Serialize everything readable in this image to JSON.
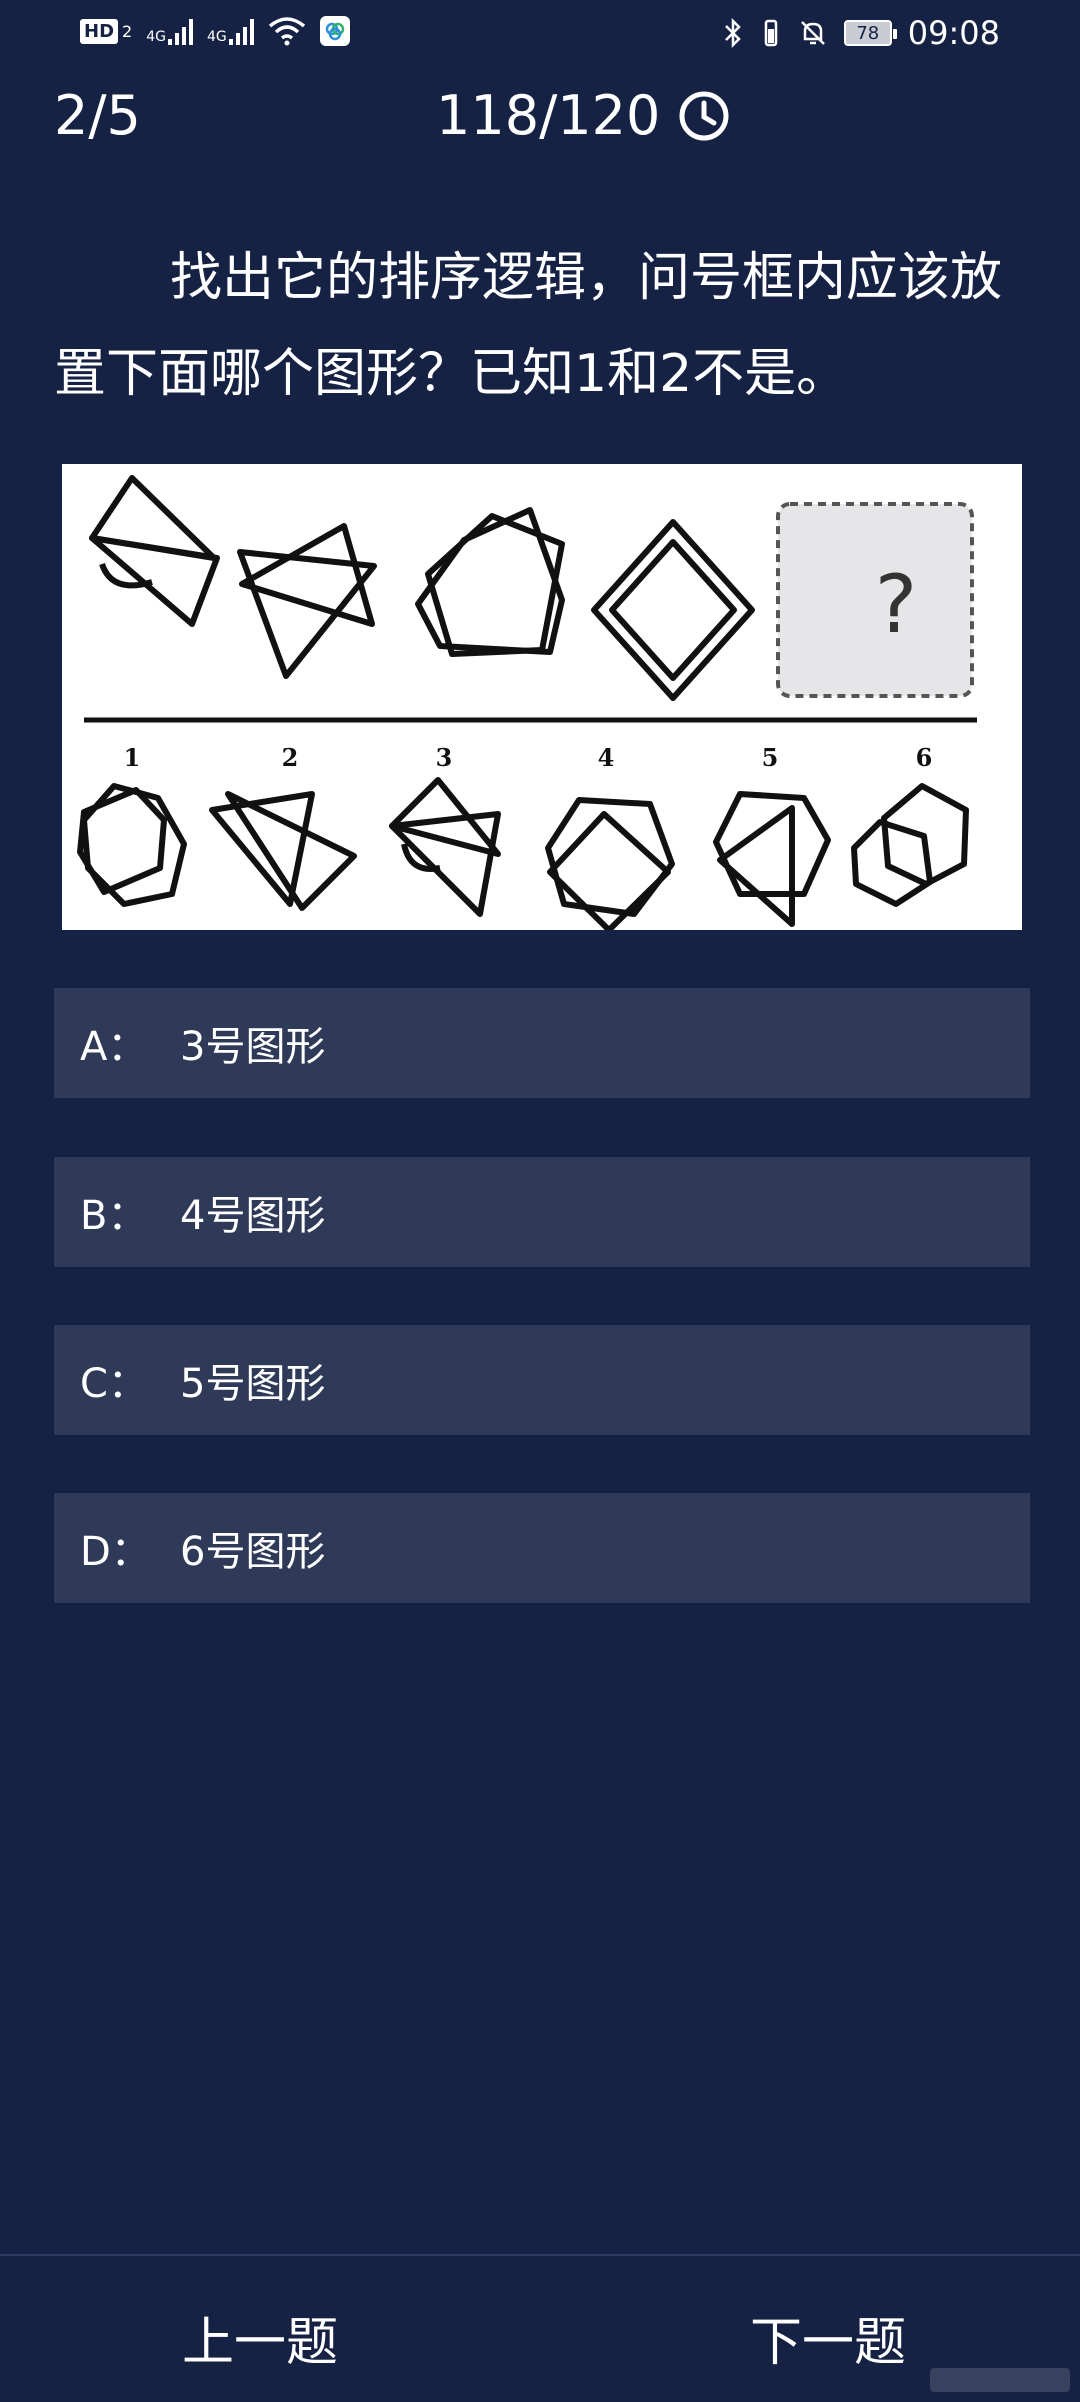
{
  "status_bar": {
    "hd_label": "HD",
    "hd_sub": "2",
    "net1": "4G",
    "net2": "4G",
    "battery": "78",
    "time": "09:08"
  },
  "header": {
    "progress": "2/5",
    "timer": "118/120"
  },
  "question": {
    "text": "找出它的排序逻辑，问号框内应该放置下面哪个图形？已知1和2不是。"
  },
  "puzzle": {
    "question_mark": "?",
    "labels": [
      "1",
      "2",
      "3",
      "4",
      "5",
      "6"
    ]
  },
  "options": [
    {
      "letter": "A：",
      "text": "3号图形"
    },
    {
      "letter": "B：",
      "text": "4号图形"
    },
    {
      "letter": "C：",
      "text": "5号图形"
    },
    {
      "letter": "D：",
      "text": "6号图形"
    }
  ],
  "nav": {
    "prev": "上一题",
    "next": "下一题"
  }
}
